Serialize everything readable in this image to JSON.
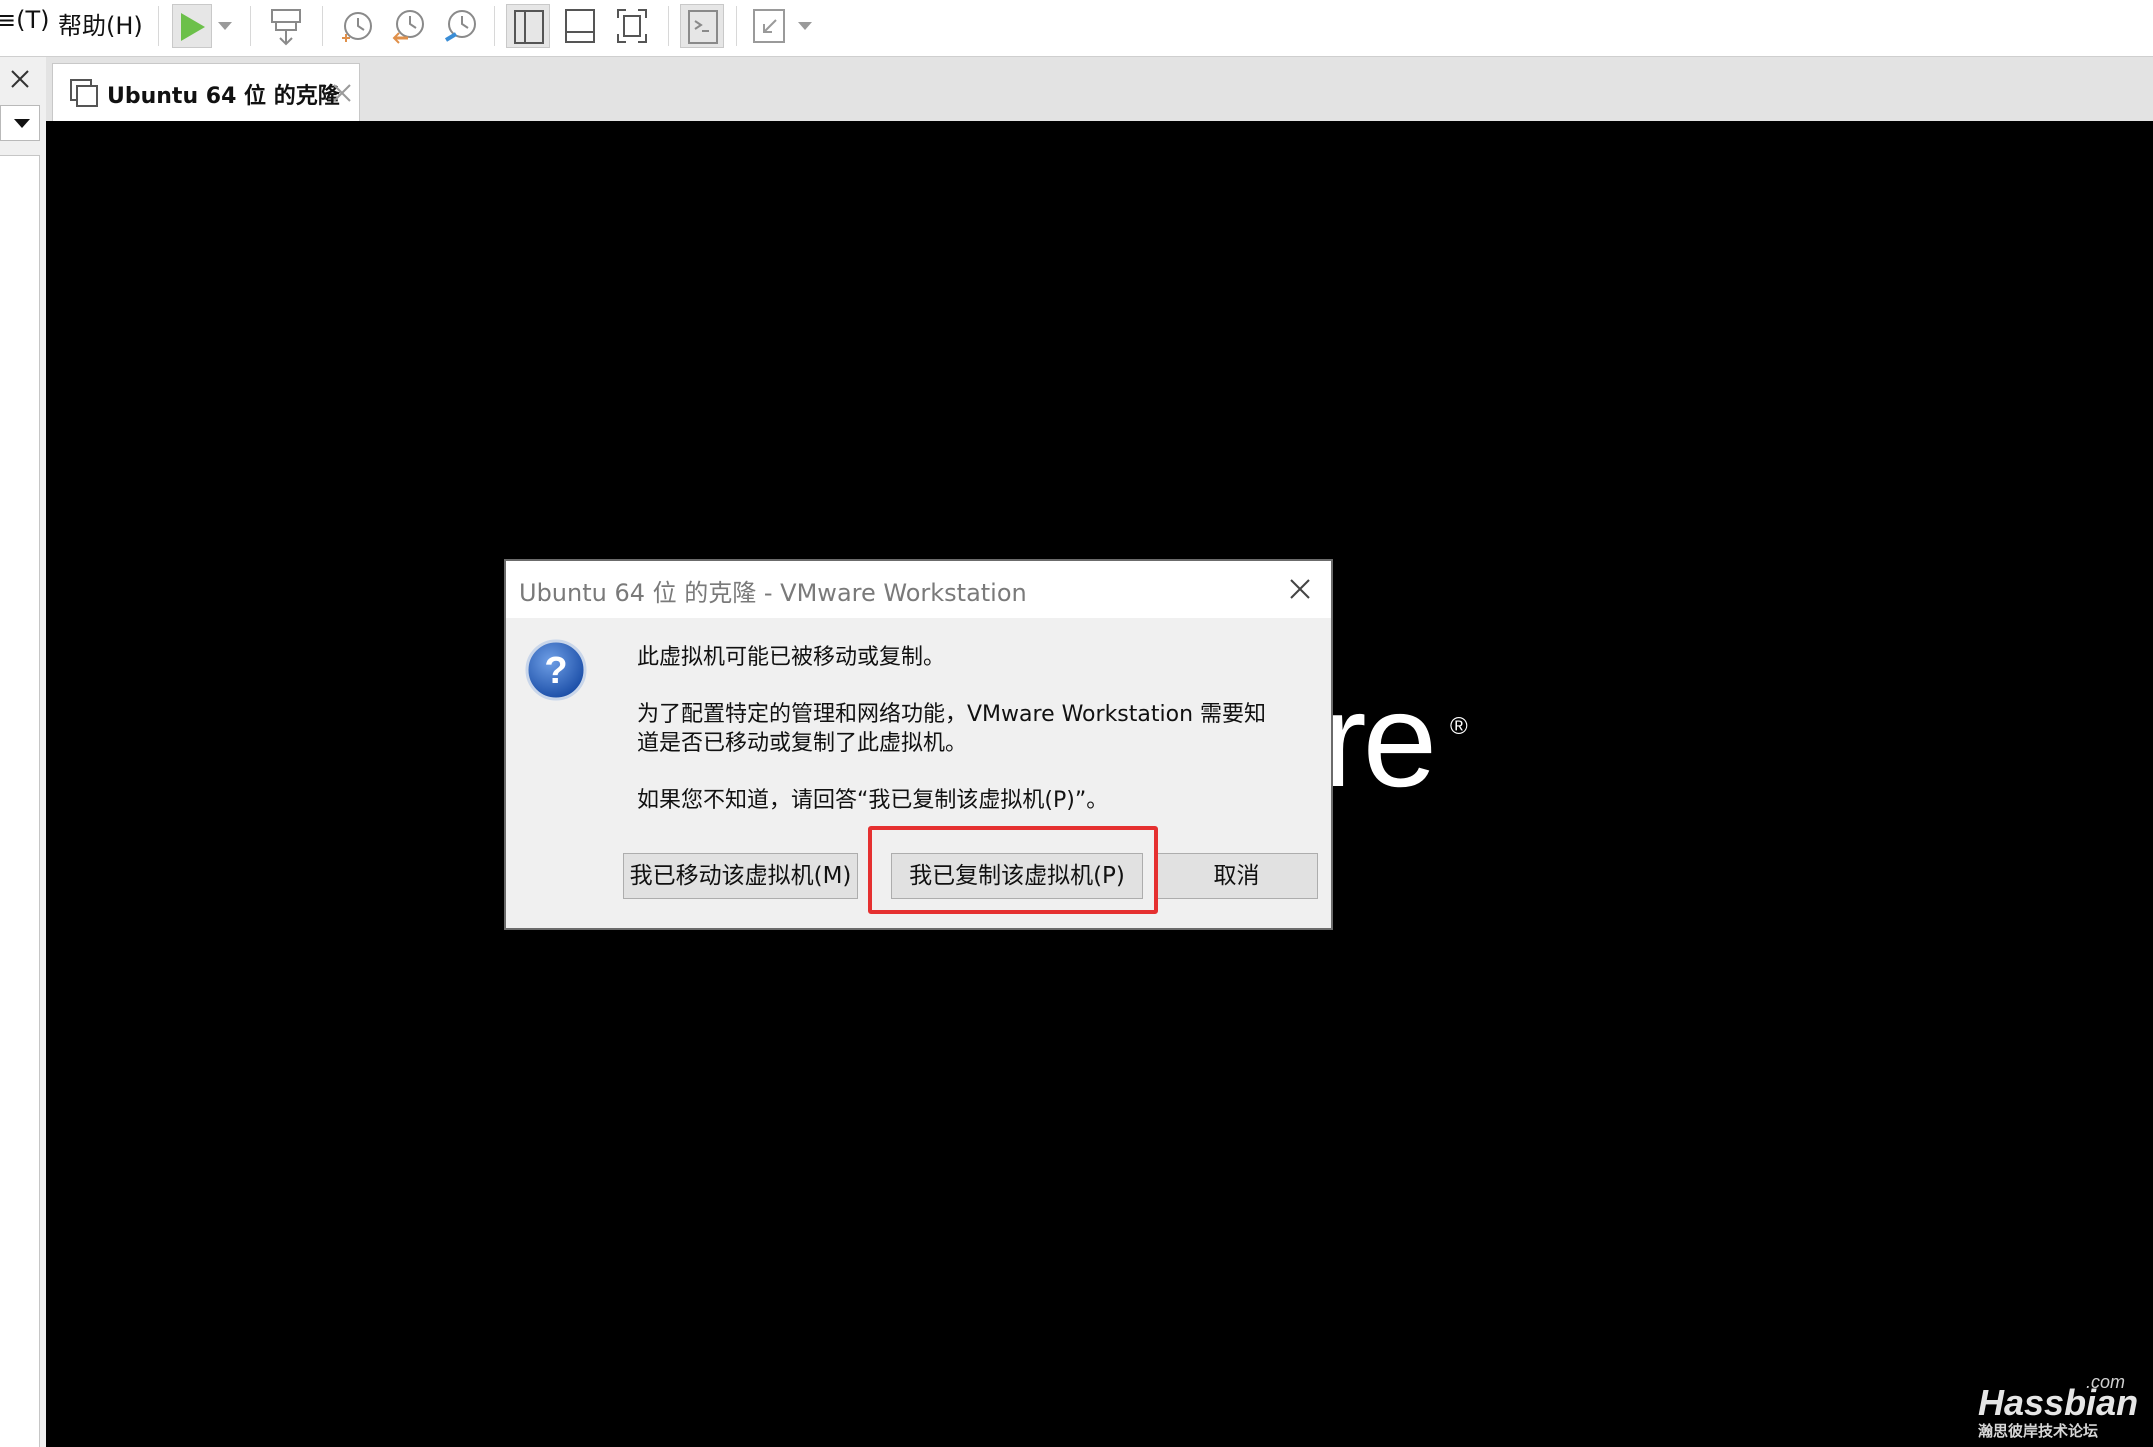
{
  "menubar": {
    "tools_fragment": "≡(T)",
    "help": "帮助(H)"
  },
  "tab": {
    "title": "Ubuntu 64 位 的克隆"
  },
  "vm_screen": {
    "brand_fragment": "re",
    "registered_mark": "®"
  },
  "dialog": {
    "title": "Ubuntu 64 位 的克隆 - VMware Workstation",
    "line1": "此虚拟机可能已被移动或复制。",
    "line2": "为了配置特定的管理和网络功能，VMware Workstation 需要知",
    "line3": "道是否已移动或复制了此虚拟机。",
    "line4": "如果您不知道，请回答“我已复制该虚拟机(P)”。",
    "buttons": {
      "moved": "我已移动该虚拟机(M)",
      "copied": "我已复制该虚拟机(P)",
      "cancel": "取消"
    }
  },
  "watermark": {
    "com": ".com",
    "main": "Hassbian",
    "sub": "瀚思彼岸技术论坛"
  },
  "colors": {
    "highlight": "#e53030",
    "play": "#6cc04a",
    "vm_background": "#000000"
  }
}
